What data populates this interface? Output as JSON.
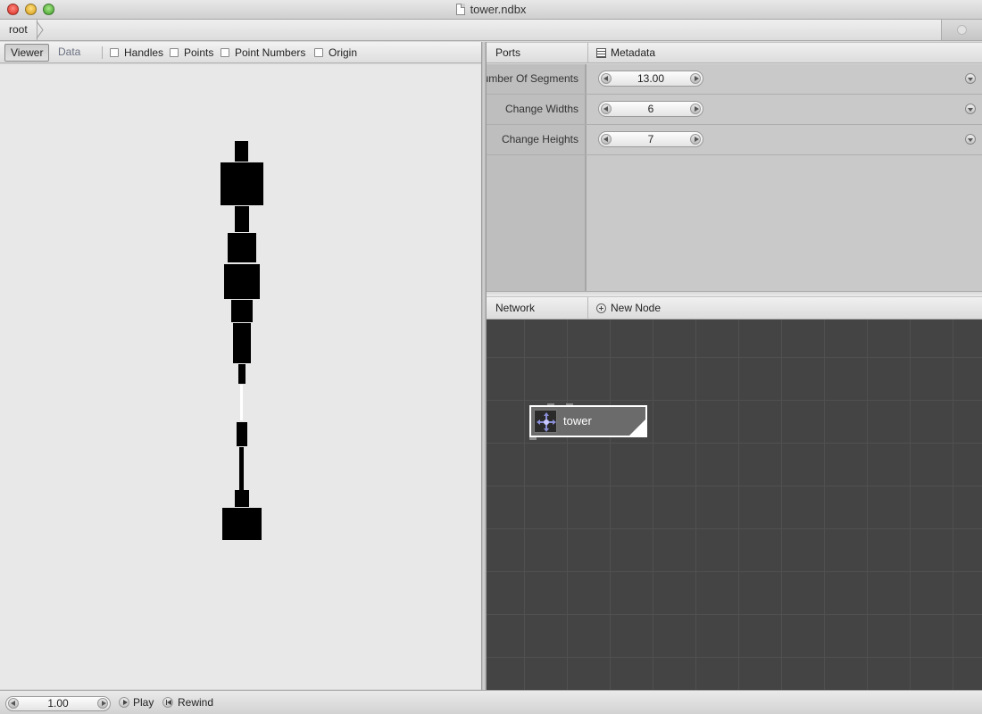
{
  "window": {
    "title": "tower.ndbx"
  },
  "breadcrumb": {
    "root_label": "root"
  },
  "viewer": {
    "tabs": [
      {
        "label": "Viewer",
        "selected": true
      },
      {
        "label": "Data",
        "selected": false
      }
    ],
    "checkboxes": [
      {
        "label": "Handles",
        "checked": false
      },
      {
        "label": "Points",
        "checked": false
      },
      {
        "label": "Point Numbers",
        "checked": false
      },
      {
        "label": "Origin",
        "checked": false
      }
    ],
    "background_color": "#e8e8e8",
    "shape_color": "#000000"
  },
  "ports_panel": {
    "tab_ports": "Ports",
    "tab_metadata": "Metadata",
    "ports": [
      {
        "label": "Number Of Segments",
        "value": "13.00"
      },
      {
        "label": "Change Widths",
        "value": "6"
      },
      {
        "label": "Change Heights",
        "value": "7"
      }
    ]
  },
  "network_panel": {
    "title": "Network",
    "new_node_label": "New Node",
    "grid_color": "#444444",
    "node": {
      "label": "tower",
      "icon": "move-icon"
    }
  },
  "playback": {
    "frame_value": "1.00",
    "play_label": "Play",
    "rewind_label": "Rewind"
  }
}
